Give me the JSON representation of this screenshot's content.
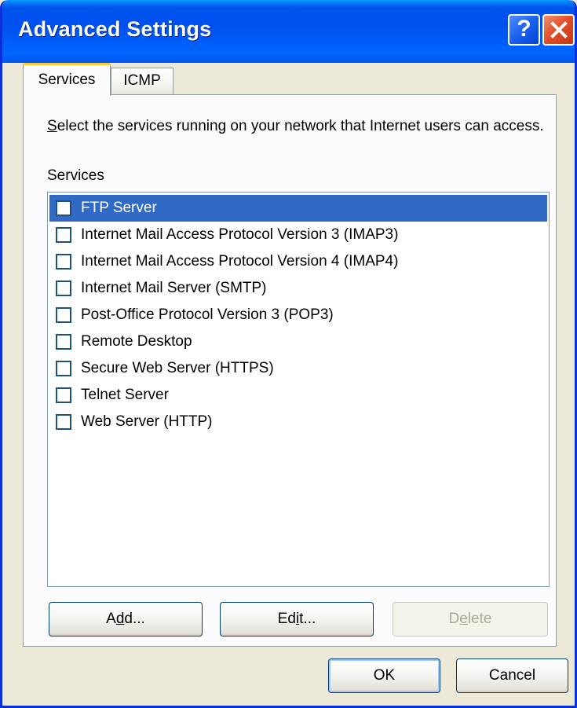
{
  "window": {
    "title": "Advanced Settings",
    "help_label": "?"
  },
  "tabs": [
    {
      "label": "Services",
      "active": true
    },
    {
      "label": "ICMP",
      "active": false
    }
  ],
  "panel": {
    "description_first_letter": "S",
    "description_rest": "elect the services running on your network that Internet users can access.",
    "list_label": "Services",
    "services": [
      {
        "label": "FTP Server",
        "checked": false,
        "selected": true
      },
      {
        "label": "Internet Mail Access Protocol Version 3 (IMAP3)",
        "checked": false,
        "selected": false
      },
      {
        "label": "Internet Mail Access Protocol Version 4 (IMAP4)",
        "checked": false,
        "selected": false
      },
      {
        "label": "Internet Mail Server (SMTP)",
        "checked": false,
        "selected": false
      },
      {
        "label": "Post-Office Protocol Version 3 (POP3)",
        "checked": false,
        "selected": false
      },
      {
        "label": "Remote Desktop",
        "checked": false,
        "selected": false
      },
      {
        "label": "Secure Web Server (HTTPS)",
        "checked": false,
        "selected": false
      },
      {
        "label": "Telnet Server",
        "checked": false,
        "selected": false
      },
      {
        "label": "Web Server (HTTP)",
        "checked": false,
        "selected": false
      }
    ],
    "buttons": {
      "add": {
        "pre": "A",
        "u": "d",
        "post": "d..."
      },
      "edit": {
        "pre": "Ed",
        "u": "i",
        "post": "t..."
      },
      "delete": {
        "pre": "D",
        "u": "e",
        "post": "lete"
      }
    }
  },
  "footer": {
    "ok_label": "OK",
    "cancel_label": "Cancel"
  },
  "colors": {
    "titlebar": "#0053EE",
    "selection": "#316AC5",
    "dialog_bg": "#ECE9D8",
    "tab_highlight": "#FFC83C"
  }
}
